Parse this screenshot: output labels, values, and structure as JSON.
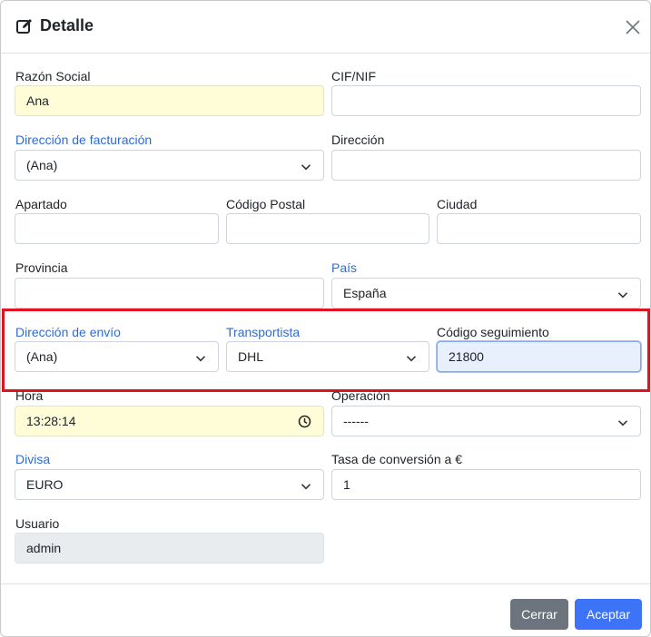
{
  "header": {
    "title": "Detalle",
    "icon": "edit-icon",
    "close_icon": "close-icon"
  },
  "fields": {
    "razon_social": {
      "label": "Razón Social",
      "value": "Ana"
    },
    "cif_nif": {
      "label": "CIF/NIF",
      "value": ""
    },
    "direccion_facturacion": {
      "label": "Dirección de facturación",
      "value": "(Ana)"
    },
    "direccion": {
      "label": "Dirección",
      "value": ""
    },
    "apartado": {
      "label": "Apartado",
      "value": ""
    },
    "codigo_postal": {
      "label": "Código Postal",
      "value": ""
    },
    "ciudad": {
      "label": "Ciudad",
      "value": ""
    },
    "provincia": {
      "label": "Provincia",
      "value": ""
    },
    "pais": {
      "label": "País",
      "value": "España"
    },
    "direccion_envio": {
      "label": "Dirección de envío",
      "value": "(Ana)"
    },
    "transportista": {
      "label": "Transportista",
      "value": "DHL"
    },
    "codigo_seguimiento": {
      "label": "Código seguimiento",
      "value": "21800"
    },
    "hora": {
      "label": "Hora",
      "value": "13:28:14"
    },
    "operacion": {
      "label": "Operación",
      "value": "------"
    },
    "divisa": {
      "label": "Divisa",
      "value": "EURO"
    },
    "tasa_conversion": {
      "label": "Tasa de conversión a €",
      "value": "1"
    },
    "usuario": {
      "label": "Usuario",
      "value": "admin"
    }
  },
  "footer": {
    "close_label": "Cerrar",
    "accept_label": "Aceptar"
  },
  "colors": {
    "link_label": "#2e6bd6",
    "highlight_border": "#e0141e",
    "accept_button": "#3d74f7",
    "close_button": "#6c757d",
    "readonly_yellow": "#fefdd8"
  }
}
